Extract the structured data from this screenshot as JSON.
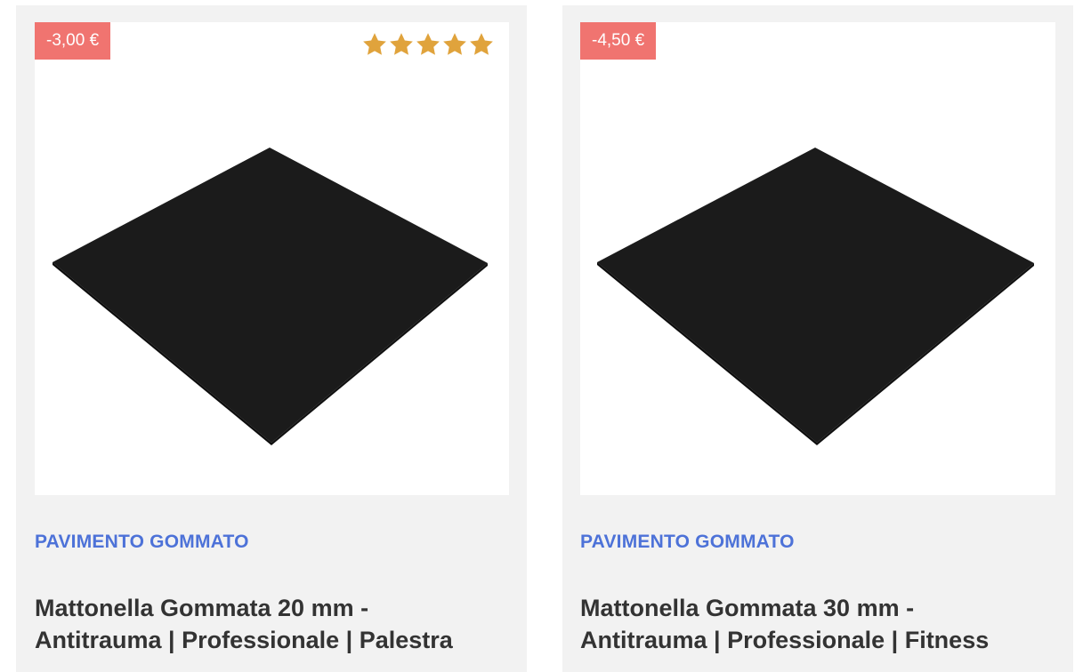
{
  "products": [
    {
      "discount": "-3,00 €",
      "rating": 5,
      "rating_max": 5,
      "category": "PAVIMENTO GOMMATO",
      "title_line1": "Mattonella Gommata 20 mm -",
      "title_line2": "Antitrauma | Professionale | Palestra"
    },
    {
      "discount": "-4,50 €",
      "category": "PAVIMENTO GOMMATO",
      "title_line1": "Mattonella Gommata 30 mm -",
      "title_line2": "Antitrauma | Professionale | Fitness"
    }
  ],
  "colors": {
    "badge": "#f07470",
    "star": "#e0a33c",
    "category": "#4d72d8",
    "title": "#333333",
    "card_bg": "#f2f2f2",
    "tile": "#1a1a1a"
  },
  "icons": {
    "star": "star-icon",
    "product_image": "rubber-tile-image"
  }
}
